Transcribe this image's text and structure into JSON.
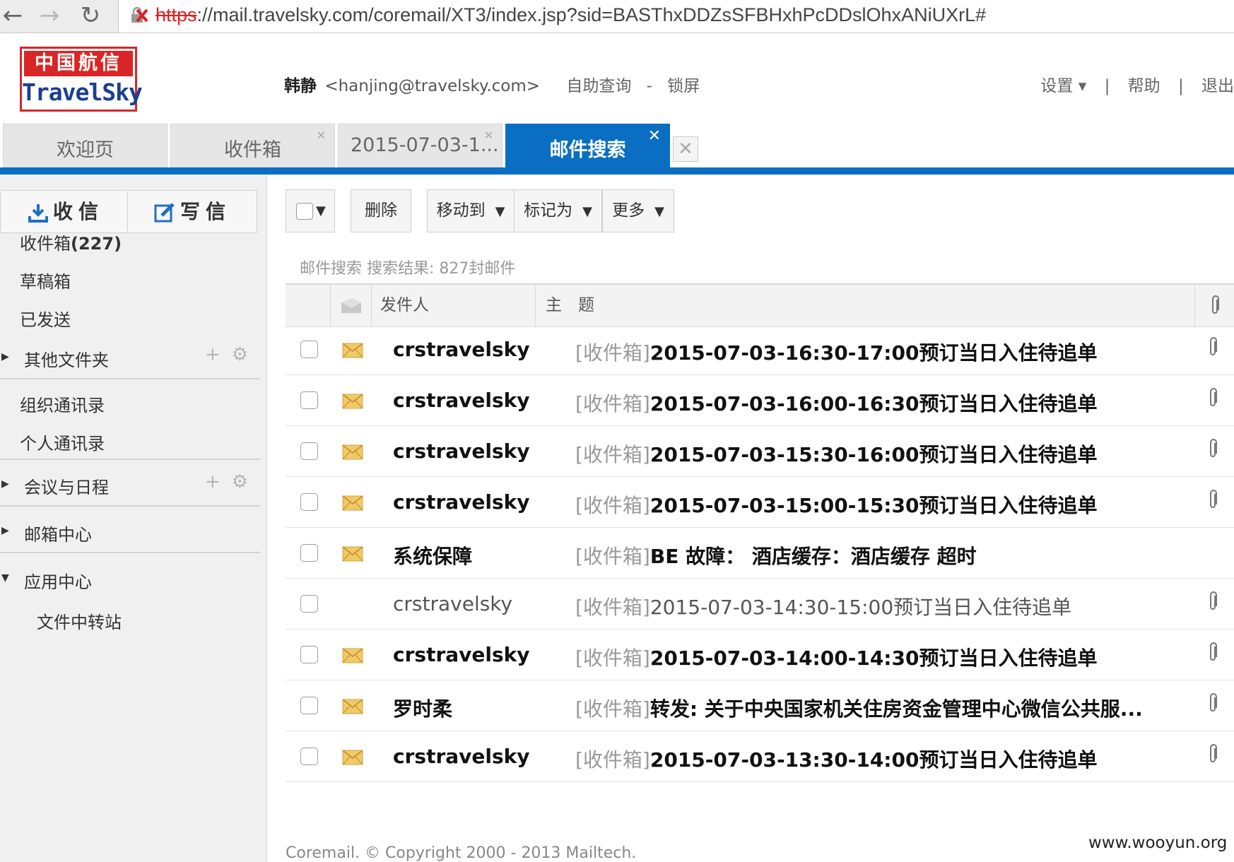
{
  "browser": {
    "url_scheme": "https",
    "url_rest": "://mail.travelsky.com/coremail/XT3/index.jsp?sid=BASThxDDZsSFBHxhPcDDslOhxANiUXrL#"
  },
  "header": {
    "logo_cn": "中国航信",
    "logo_en": "TravelSky",
    "user_name": "韩静",
    "user_email": "<hanjing@travelsky.com>",
    "self_query": "自助查询",
    "dash": "-",
    "lock": "锁屏",
    "settings": "设置 ▾",
    "sep1": "|",
    "help": "帮助",
    "sep2": "|",
    "logout": "退出"
  },
  "tabs": [
    {
      "label": "欢迎页"
    },
    {
      "label": "收件箱"
    },
    {
      "label": "2015-07-03-1..."
    },
    {
      "label": "邮件搜索"
    }
  ],
  "sidebar": {
    "receive": "收信",
    "write": "写信",
    "inbox": "收件箱",
    "inbox_count": "(227)",
    "drafts": "草稿箱",
    "sent": "已发送",
    "other_folders": "其他文件夹",
    "org_contacts": "组织通讯录",
    "personal_contacts": "个人通讯录",
    "meetings": "会议与日程",
    "mailbox_center": "邮箱中心",
    "app_center": "应用中心",
    "file_transfer": "文件中转站"
  },
  "toolbar": {
    "delete": "删除",
    "move_to": "移动到",
    "mark_as": "标记为",
    "more": "更多"
  },
  "search_info": "邮件搜索  搜索结果: 827封邮件",
  "columns": {
    "sender": "发件人",
    "subject": "主　题"
  },
  "emails": [
    {
      "sender": "crstravelsky",
      "folder": "[收件箱]",
      "subject": "2015-07-03-16:30-17:00预订当日入住待追单",
      "unread": true,
      "attach": true
    },
    {
      "sender": "crstravelsky",
      "folder": "[收件箱]",
      "subject": "2015-07-03-16:00-16:30预订当日入住待追单",
      "unread": true,
      "attach": true
    },
    {
      "sender": "crstravelsky",
      "folder": "[收件箱]",
      "subject": "2015-07-03-15:30-16:00预订当日入住待追单",
      "unread": true,
      "attach": true
    },
    {
      "sender": "crstravelsky",
      "folder": "[收件箱]",
      "subject": "2015-07-03-15:00-15:30预订当日入住待追单",
      "unread": true,
      "attach": true
    },
    {
      "sender": "系统保障",
      "folder": "[收件箱]",
      "subject": "BE 故障：  酒店缓存：酒店缓存 超时",
      "unread": true,
      "attach": false
    },
    {
      "sender": "crstravelsky",
      "folder": "[收件箱]",
      "subject": "2015-07-03-14:30-15:00预订当日入住待追单",
      "unread": false,
      "attach": true
    },
    {
      "sender": "crstravelsky",
      "folder": "[收件箱]",
      "subject": "2015-07-03-14:00-14:30预订当日入住待追单",
      "unread": true,
      "attach": true
    },
    {
      "sender": "罗时柔",
      "folder": "[收件箱]",
      "subject": "转发: 关于中央国家机关住房资金管理中心微信公共服...",
      "unread": true,
      "attach": true
    },
    {
      "sender": "crstravelsky",
      "folder": "[收件箱]",
      "subject": "2015-07-03-13:30-14:00预订当日入住待追单",
      "unread": true,
      "attach": true
    }
  ],
  "footer": "Coremail. © Copyright 2000 - 2013 Mailtech.",
  "watermark": "www.wooyun.org",
  "colors": {
    "accent": "#0a6fc2",
    "logo_red": "#d92525",
    "envelope": "#f0c96a"
  }
}
